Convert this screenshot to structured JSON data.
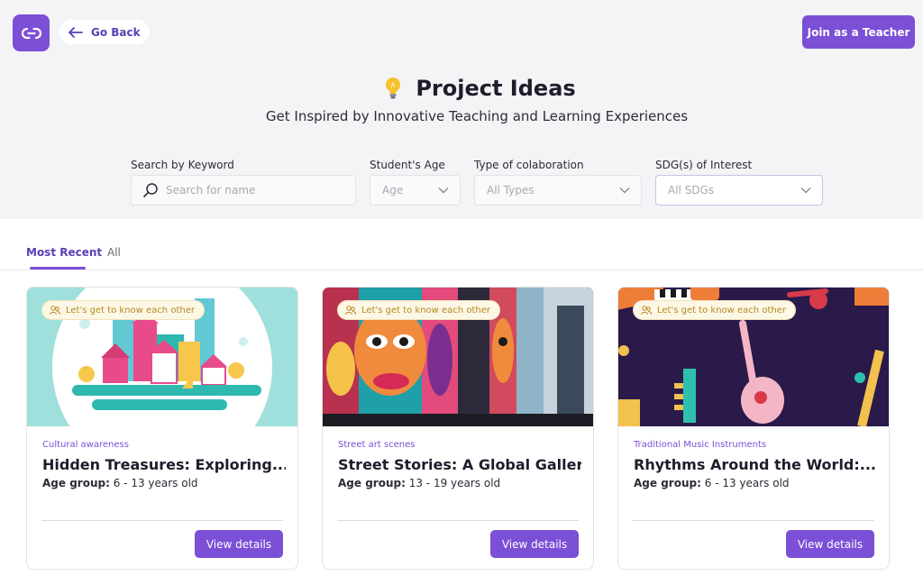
{
  "header": {
    "back_label": "Go Back",
    "join_label": "Join as a Teacher"
  },
  "hero": {
    "title": "Project Ideas",
    "subtitle": "Get Inspired by Innovative Teaching and Learning Experiences"
  },
  "filters": {
    "keyword_label": "Search by Keyword",
    "keyword_placeholder": "Search for name",
    "age_label": "Student's Age",
    "age_value": "Age",
    "type_label": "Type of colaboration",
    "type_value": "All Types",
    "sdg_label": "SDG(s) of Interest",
    "sdg_value": "All SDGs"
  },
  "tabs": [
    {
      "label": "Most Recent",
      "active": true
    },
    {
      "label": "All",
      "active": false
    }
  ],
  "cards": [
    {
      "badge": "Let's get to know each other",
      "category": "Cultural awareness",
      "title": "Hidden Treasures: Exploring...",
      "age_label": "Age group:",
      "age_value": "6 - 13 years old",
      "button": "View details"
    },
    {
      "badge": "Let's get to know each other",
      "category": "Street art scenes",
      "title": "Street Stories: A Global Gallery...",
      "age_label": "Age group:",
      "age_value": "13 - 19 years old",
      "button": "View details"
    },
    {
      "badge": "Let's get to know each other",
      "category": "Traditional Music Instruments",
      "title": "Rhythms Around the World:...",
      "age_label": "Age group:",
      "age_value": "6 - 13 years old",
      "button": "View details"
    }
  ],
  "icons": {
    "logo": "infinity-link-icon",
    "back": "arrow-left-icon",
    "title": "lightbulb-icon",
    "search": "search-icon",
    "dropdown": "chevron-down-icon",
    "badge": "users-icon"
  },
  "colors": {
    "accent": "#7b4fd6",
    "badge_text": "#b58a1d",
    "header_bg": "#f4f4f6"
  }
}
